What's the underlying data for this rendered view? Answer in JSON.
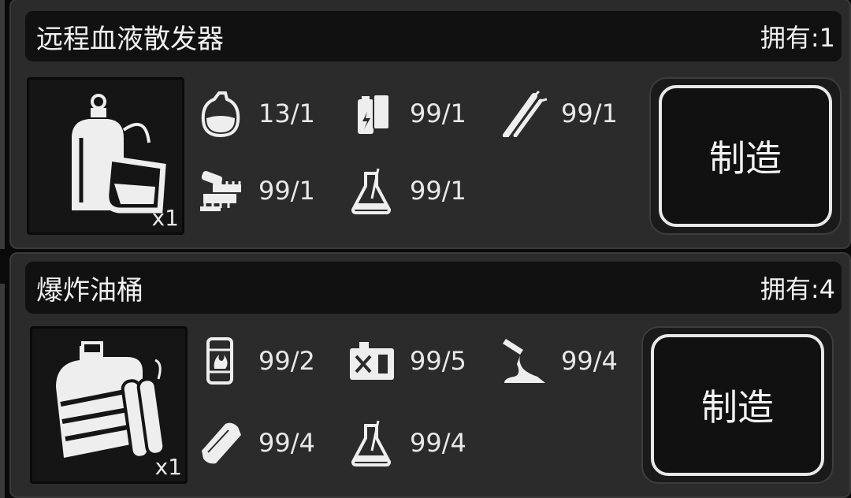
{
  "recipes": [
    {
      "name": "远程血液散发器",
      "owned": "拥有:1",
      "output_qty": "x1",
      "output_icon": "blood-dispenser-icon",
      "craft_label": "制造",
      "materials": [
        {
          "icon": "blood-bag-icon",
          "count": "13/1"
        },
        {
          "icon": "battery-icon",
          "count": "99/1"
        },
        {
          "icon": "tube-icon",
          "count": "99/1"
        },
        {
          "icon": "circuit-parts-icon",
          "count": "99/1"
        },
        {
          "icon": "flask-icon",
          "count": "99/1"
        }
      ]
    },
    {
      "name": "爆炸油桶",
      "owned": "拥有:4",
      "output_qty": "x1",
      "output_icon": "explosive-barrel-icon",
      "craft_label": "制造",
      "materials": [
        {
          "icon": "fuel-barrel-icon",
          "count": "99/2"
        },
        {
          "icon": "jerrycan-icon",
          "count": "99/5"
        },
        {
          "icon": "funnel-icon",
          "count": "99/4"
        },
        {
          "icon": "tape-icon",
          "count": "99/4"
        },
        {
          "icon": "flask-icon",
          "count": "99/4"
        }
      ]
    }
  ]
}
